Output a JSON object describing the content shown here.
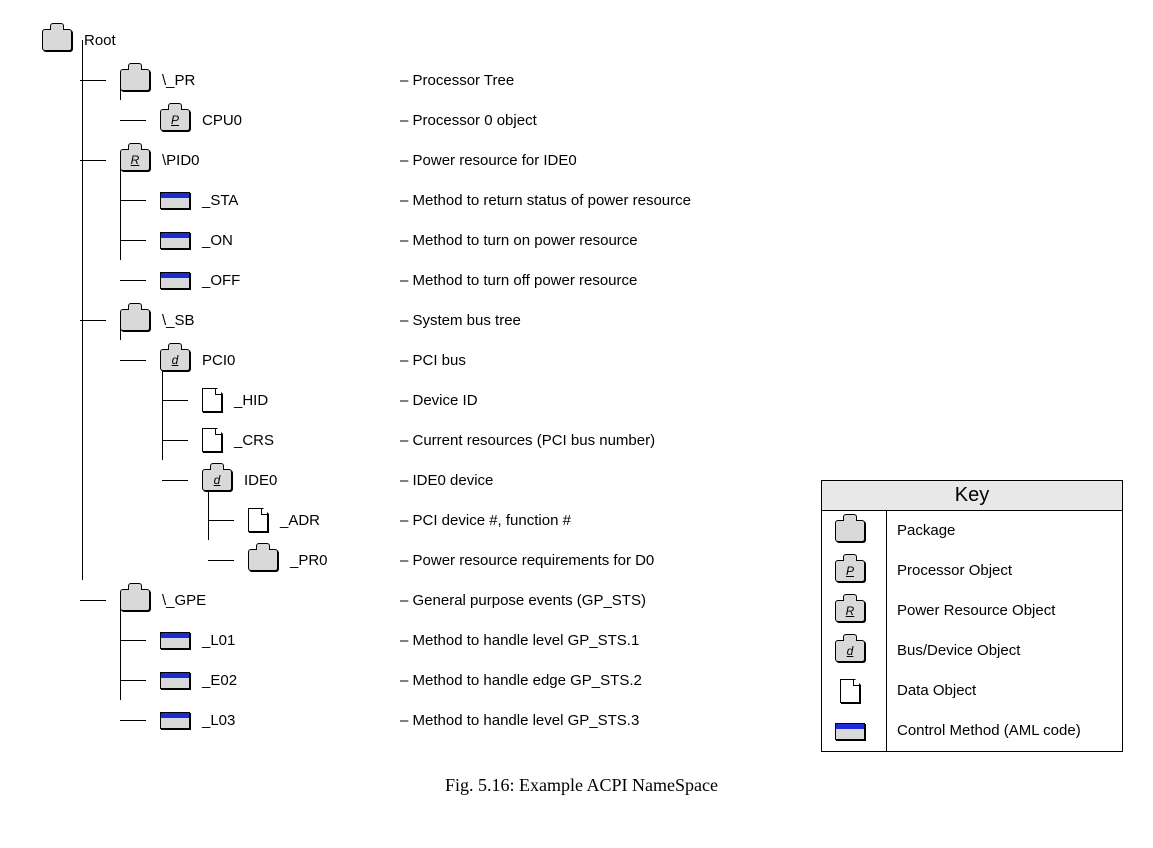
{
  "tree": {
    "root": "Root",
    "nodes": [
      {
        "label": "\\_PR",
        "desc": "– Processor Tree"
      },
      {
        "label": "CPU0",
        "desc": "– Processor 0 object"
      },
      {
        "label": "\\PID0",
        "desc": "– Power resource for IDE0"
      },
      {
        "label": "_STA",
        "desc": "– Method to return status of power resource"
      },
      {
        "label": "_ON",
        "desc": "– Method to turn on power resource"
      },
      {
        "label": "_OFF",
        "desc": "– Method to turn off power resource"
      },
      {
        "label": "\\_SB",
        "desc": "– System bus tree"
      },
      {
        "label": "PCI0",
        "desc": "– PCI bus"
      },
      {
        "label": "_HID",
        "desc": "– Device ID"
      },
      {
        "label": "_CRS",
        "desc": "– Current resources (PCI bus number)"
      },
      {
        "label": "IDE0",
        "desc": "– IDE0 device"
      },
      {
        "label": "_ADR",
        "desc": "– PCI device #, function #"
      },
      {
        "label": "_PR0",
        "desc": "– Power resource requirements for D0"
      },
      {
        "label": "\\_GPE",
        "desc": "– General purpose events (GP_STS)"
      },
      {
        "label": "_L01",
        "desc": "– Method to handle level GP_STS.1"
      },
      {
        "label": "_E02",
        "desc": "– Method to handle edge GP_STS.2"
      },
      {
        "label": "_L03",
        "desc": "– Method to handle level GP_STS.3"
      }
    ]
  },
  "key": {
    "title": "Key",
    "items": [
      "Package",
      "Processor Object",
      "Power Resource Object",
      "Bus/Device Object",
      "Data Object",
      "Control Method (AML code)"
    ]
  },
  "caption": "Fig. 5.16: Example ACPI NameSpace"
}
